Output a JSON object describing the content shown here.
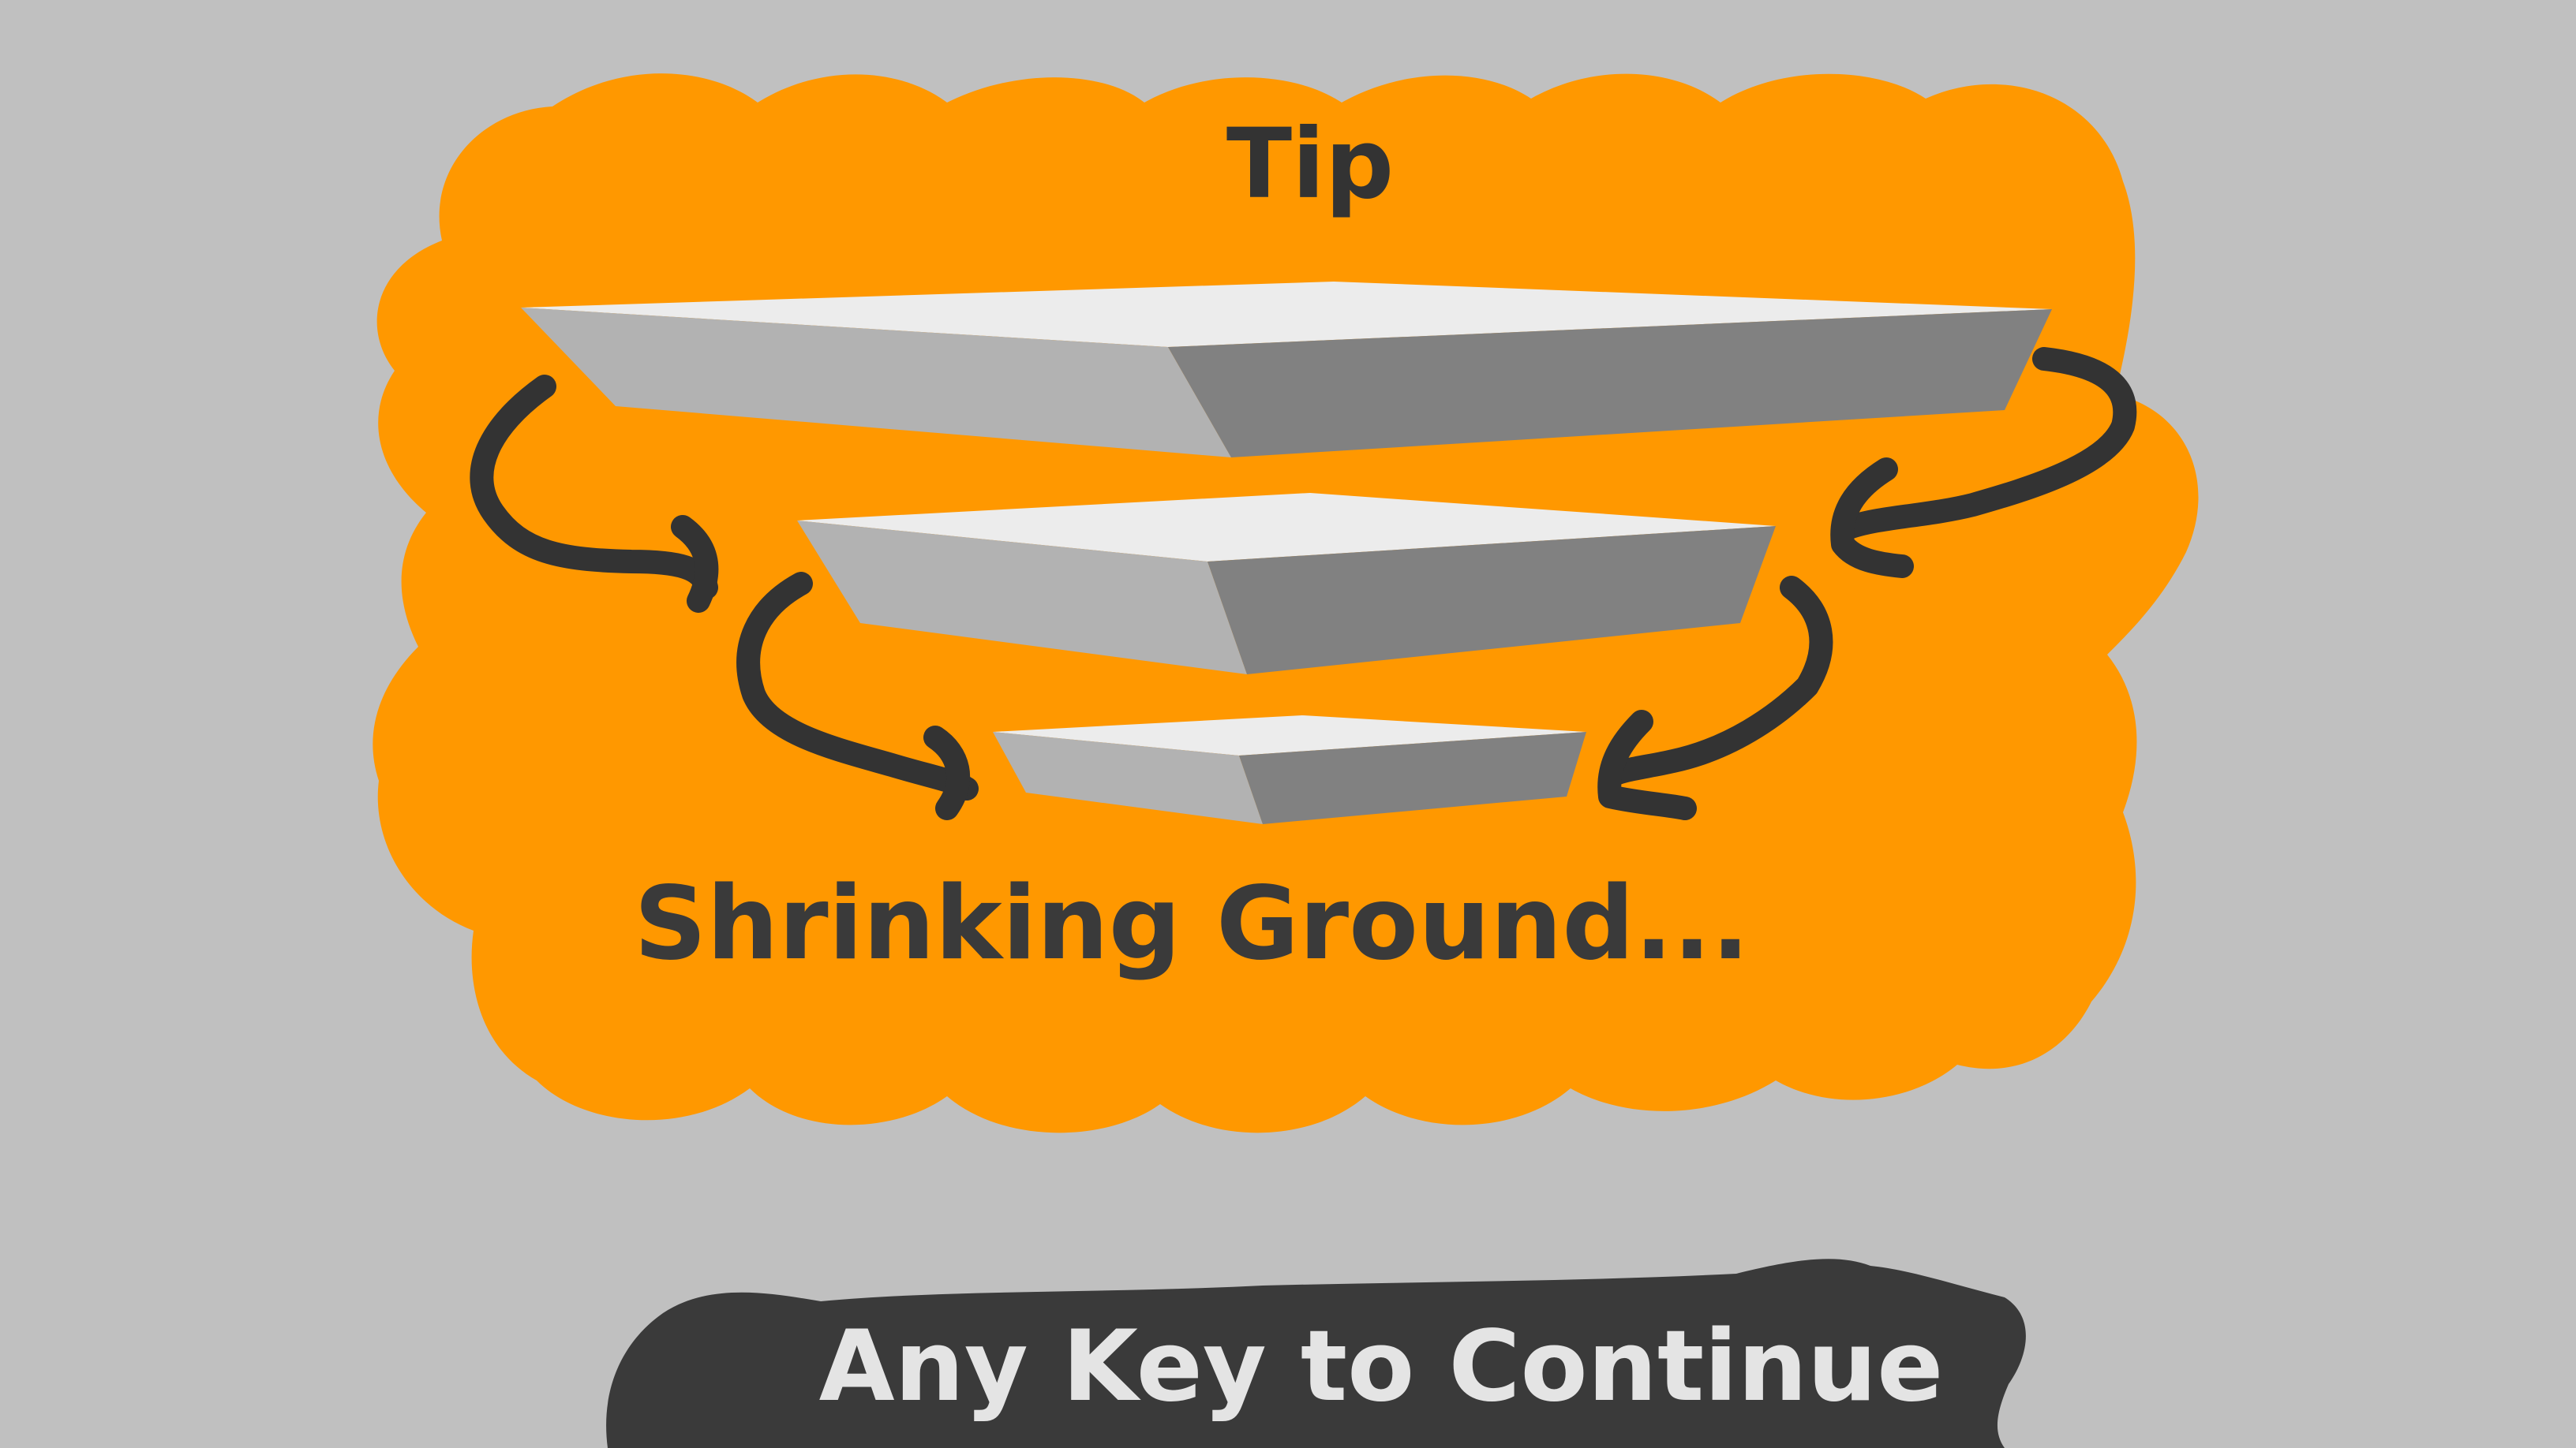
{
  "tip_panel": {
    "title": "Tip",
    "caption": "Shrinking Ground...",
    "background_color": "#ff9800"
  },
  "illustration": {
    "description_icon": "shrinking-platforms-icon",
    "platform_top_color": "#ececec",
    "platform_left_color": "#b2b2b2",
    "platform_right_color": "#818181",
    "arrow_color": "#333333"
  },
  "continue_prompt": {
    "label": "Any Key to Continue",
    "background_color": "#3a3a3a",
    "text_color": "#e4e4e4"
  },
  "background_color": "#c0c0c0"
}
